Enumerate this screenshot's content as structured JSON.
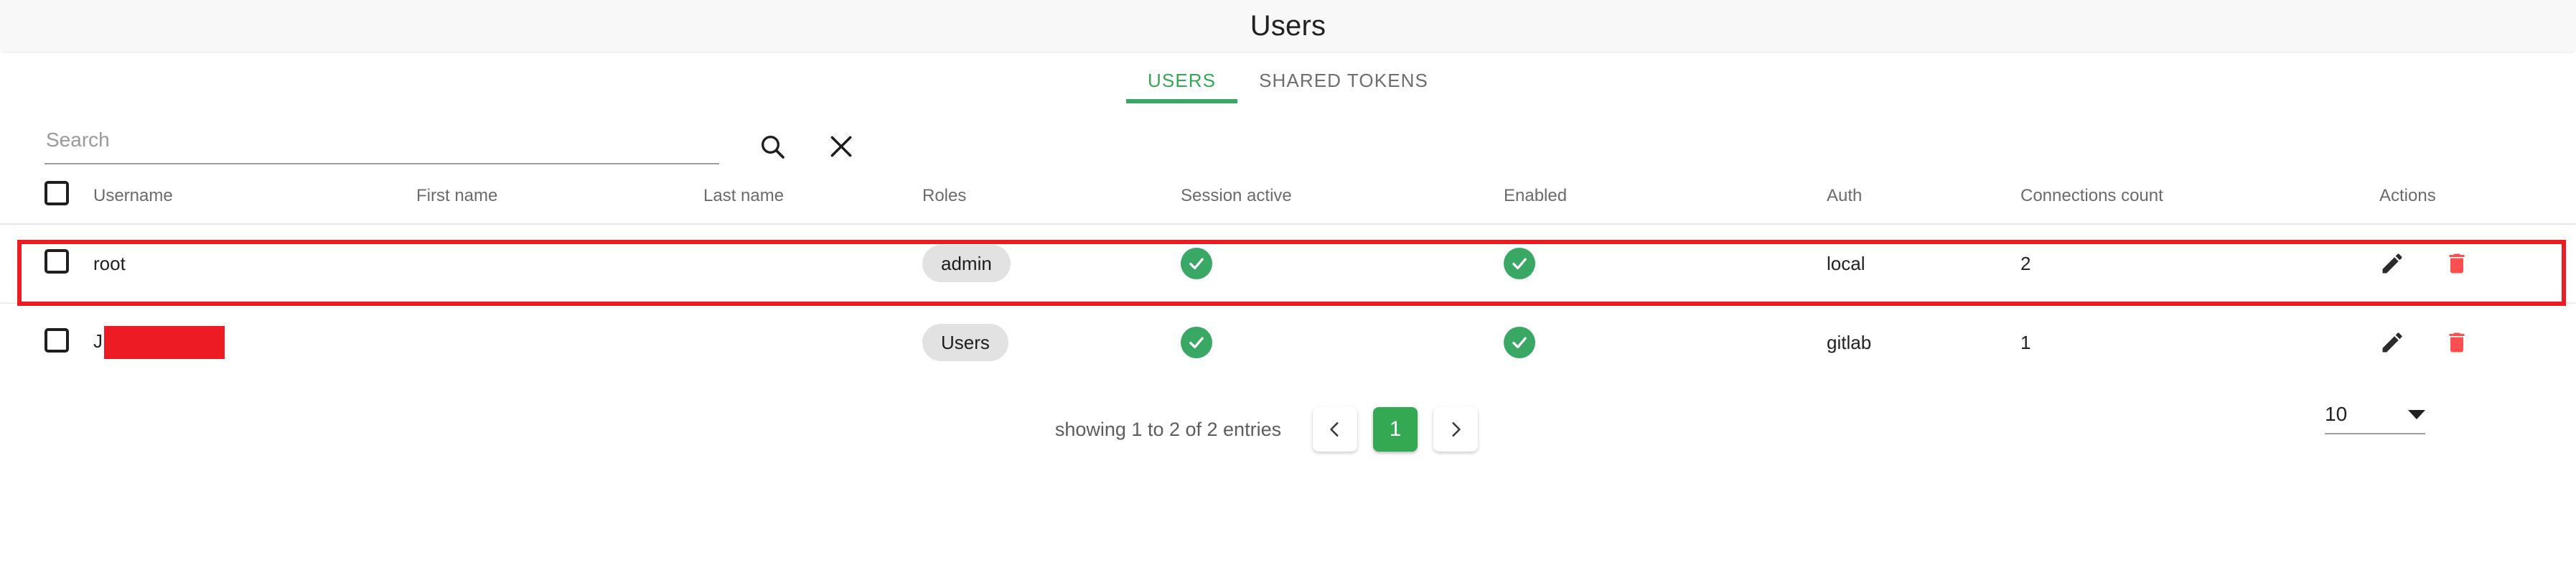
{
  "header": {
    "title": "Users"
  },
  "tabs": [
    {
      "label": "USERS",
      "active": true
    },
    {
      "label": "SHARED TOKENS",
      "active": false
    }
  ],
  "search": {
    "placeholder": "Search",
    "value": "",
    "search_icon": "search-icon",
    "clear_icon": "close-icon"
  },
  "table": {
    "columns": [
      "Username",
      "First name",
      "Last name",
      "Roles",
      "Session active",
      "Enabled",
      "Auth",
      "Connections count",
      "Actions"
    ],
    "rows": [
      {
        "username": "root",
        "first_name": "",
        "last_name": "",
        "role": "admin",
        "session_active": true,
        "enabled": true,
        "auth": "local",
        "connections_count": "2",
        "redacted": false,
        "highlighted": false
      },
      {
        "username": "J",
        "first_name": "",
        "last_name": "",
        "role": "Users",
        "session_active": true,
        "enabled": true,
        "auth": "gitlab",
        "connections_count": "1",
        "redacted": true,
        "highlighted": true
      }
    ]
  },
  "footer": {
    "showing_text": "showing 1 to 2 of 2 entries",
    "prev_label": "‹",
    "current_page": "1",
    "next_label": "›",
    "page_size": "10"
  },
  "colors": {
    "accent_green": "#34a853",
    "status_green": "#3aa865",
    "delete_red": "#fc5050",
    "annotation_red": "#ed1c24",
    "redaction_red": "#ed1c24",
    "chip_gray": "#e2e2e2",
    "header_bg": "#f8f8f8"
  }
}
